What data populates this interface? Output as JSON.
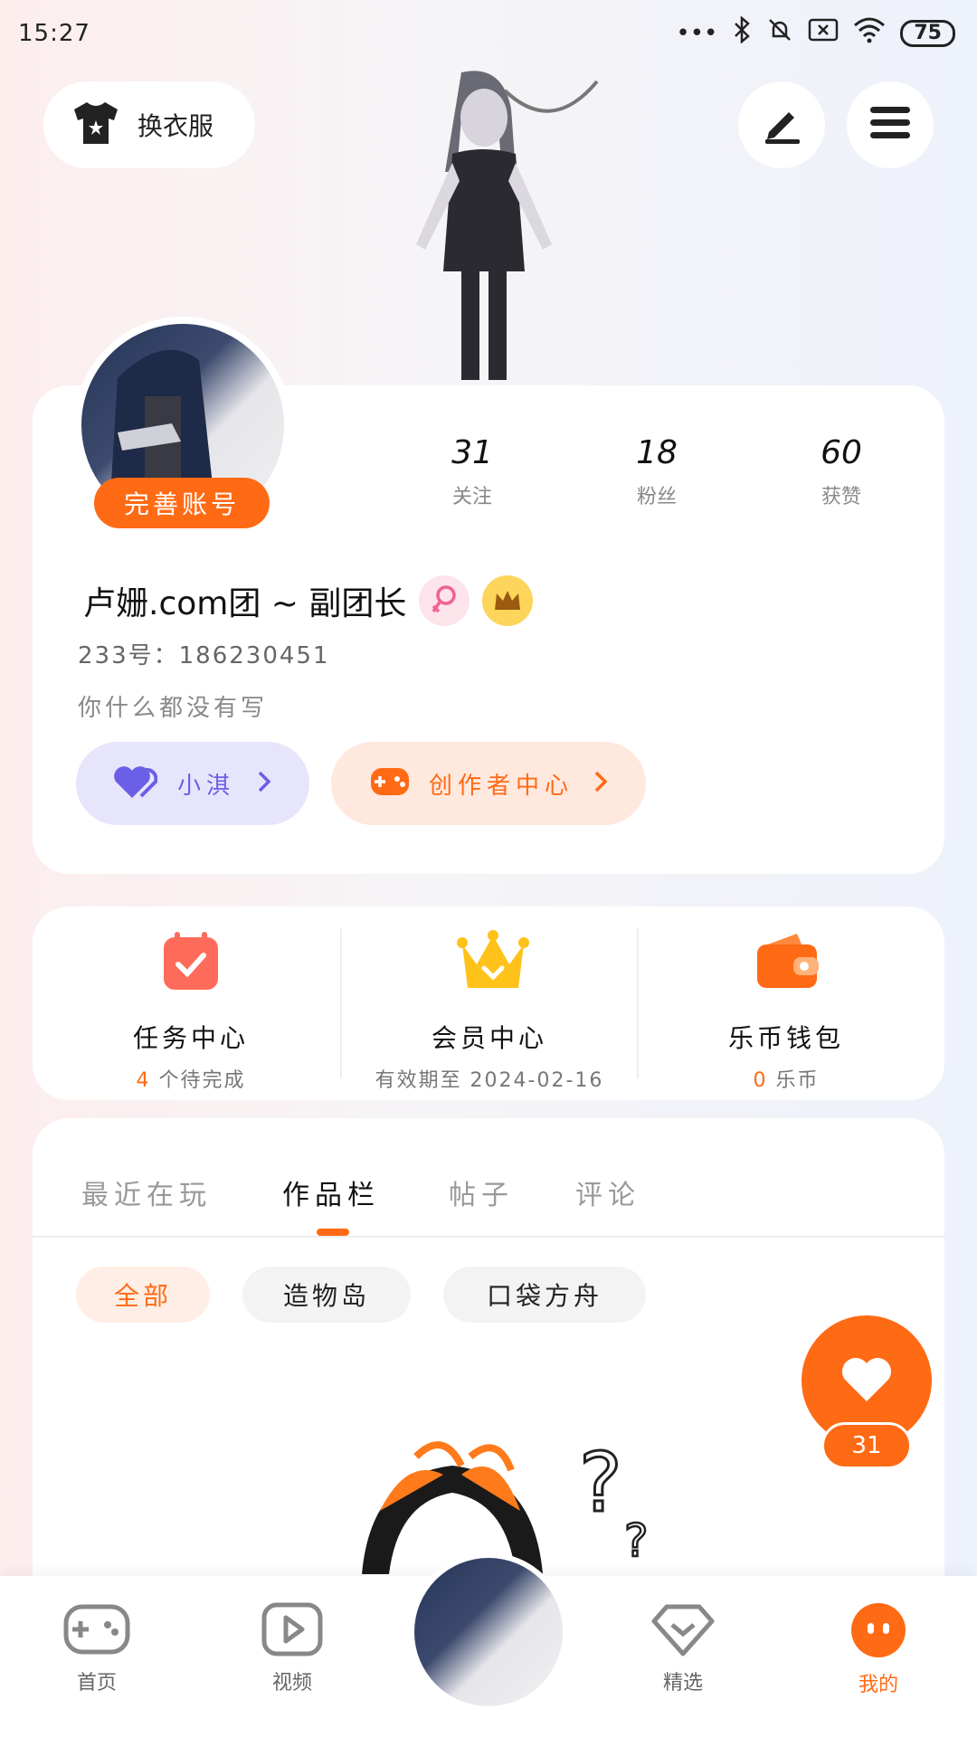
{
  "status_bar": {
    "time": "15:27",
    "battery": "75"
  },
  "top": {
    "wardrobe_label": "换衣服"
  },
  "profile": {
    "complete_label": "完善账号",
    "stats": [
      {
        "num": "31",
        "label": "关注"
      },
      {
        "num": "18",
        "label": "粉丝"
      },
      {
        "num": "60",
        "label": "获赞"
      }
    ],
    "username": "卢姗.com团 ~ 副团长",
    "uid": "233号：186230451",
    "bio": "你什么都没有写",
    "chip_xiaoqi": "小淇",
    "chip_creator": "创作者中心"
  },
  "services": [
    {
      "name": "任务中心",
      "sub_hl": "4",
      "sub": "个待完成"
    },
    {
      "name": "会员中心",
      "sub_hl": "",
      "sub": "有效期至 2024-02-16"
    },
    {
      "name": "乐币钱包",
      "sub_hl": "0",
      "sub": "乐币"
    }
  ],
  "tabs": [
    "最近在玩",
    "作品栏",
    "帖子",
    "评论"
  ],
  "filters": [
    "全部",
    "造物岛",
    "口袋方舟"
  ],
  "like_count": "31",
  "nav": [
    "首页",
    "视频",
    "精选",
    "我的"
  ],
  "colors": {
    "accent": "#ff6a14",
    "purple": "#6a5fe6"
  }
}
